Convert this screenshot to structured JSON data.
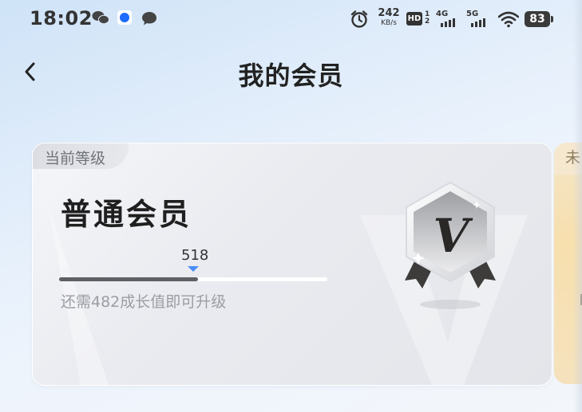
{
  "status_bar": {
    "time": "18:02",
    "net_speed_value": "242",
    "net_speed_unit": "KB/s",
    "hd_label": "HD",
    "sim_slots": "12",
    "signal1_label": "4G",
    "signal2_label": "5G",
    "battery": "83",
    "icons": [
      "wechat-icon",
      "app-icon",
      "chat-icon",
      "alarm-icon",
      "wifi-icon",
      "battery-icon"
    ]
  },
  "header": {
    "back_icon": "chevron-left-icon",
    "title": "我的会员"
  },
  "current_card": {
    "tab_label": "当前等级",
    "level_name": "普通会员",
    "growth_value": "518",
    "progress_fraction": 0.518,
    "upgrade_hint": "还需482成长值即可升级",
    "badge_letter": "V",
    "accent_color": "#4a8ff5"
  },
  "next_card": {
    "tab_label": "未"
  }
}
